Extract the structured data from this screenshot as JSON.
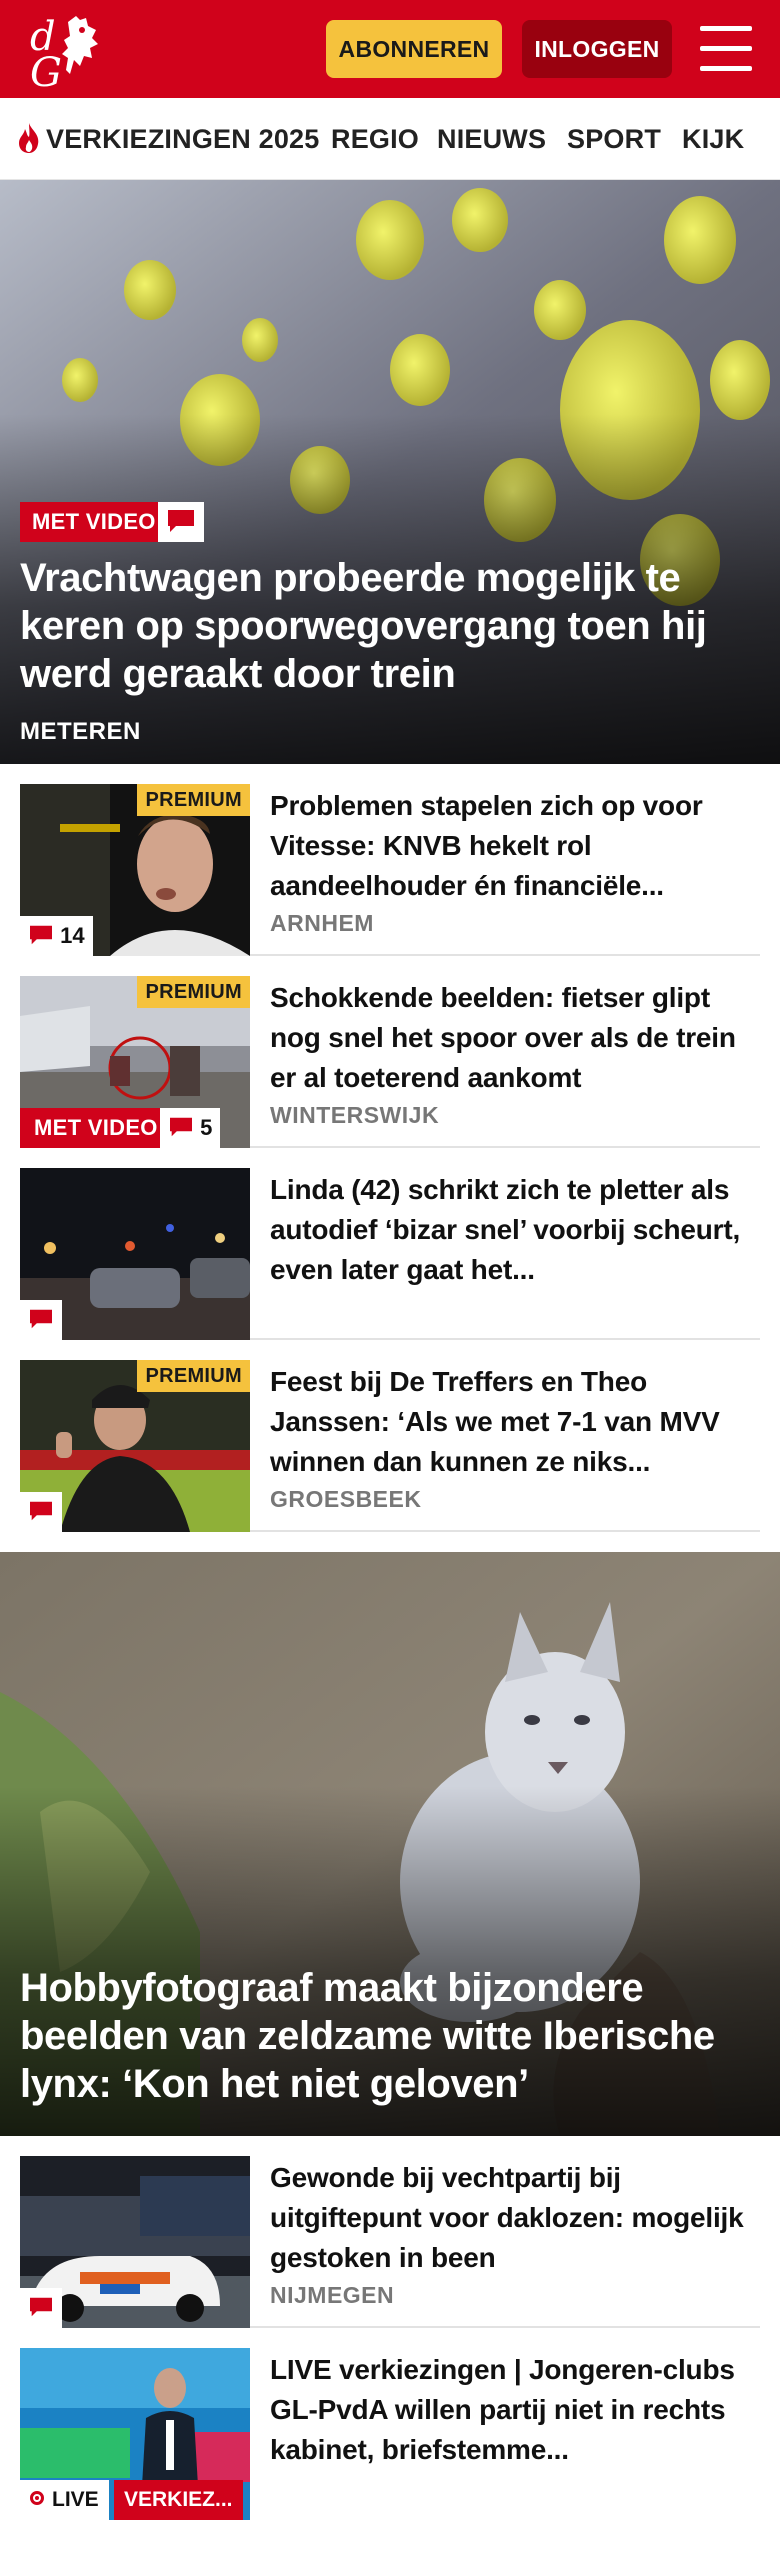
{
  "header": {
    "subscribe_label": "ABONNEREN",
    "login_label": "INLOGGEN",
    "brand_color": "#d0021b",
    "subscribe_color": "#f5c23d"
  },
  "nav": {
    "items": [
      "VERKIEZINGEN 2025",
      "REGIO",
      "NIEUWS",
      "SPORT",
      "KIJK"
    ]
  },
  "hero1": {
    "tag": "MET VIDEO",
    "title": "Vrachtwagen probeerde mogelijk te keren op spoorwegovergang toen hij werd geraakt door trein",
    "place": "METEREN"
  },
  "articles": [
    {
      "title": "Problemen stapelen zich op voor Vitesse: KNVB hekelt rol aandeelhouder én financiële...",
      "place": "ARNHEM",
      "premium": "PREMIUM",
      "comments": "14"
    },
    {
      "title": "Schokkende beelden: fietser glipt nog snel het spoor over als de trein er al toeterend aankomt",
      "place": "WINTERSWIJK",
      "premium": "PREMIUM",
      "video": "MET VIDEO",
      "comments": "5"
    },
    {
      "title": "Linda (42) schrikt zich te pletter als autodief ‘bizar snel’ voorbij scheurt, even later gaat het...",
      "place": ""
    },
    {
      "title": "Feest bij De Treffers en Theo Janssen: ‘Als we met 7-1 van MVV winnen dan kunnen ze niks...",
      "place": "GROESBEEK",
      "premium": "PREMIUM"
    }
  ],
  "hero2": {
    "title": "Hobbyfotograaf maakt bijzondere beelden van zeldzame witte Iberische lynx: ‘Kon het niet geloven’"
  },
  "articles2": [
    {
      "title": "Gewonde bij vechtpartij bij uitgiftepunt voor daklozen: mogelijk gestoken in been",
      "place": "NIJMEGEN"
    },
    {
      "title": "LIVE verkiezingen | Jongeren-clubs GL-PvdA willen partij niet in rechts kabinet, briefstemme...",
      "live": "LIVE",
      "category": "VERKIEZ..."
    }
  ]
}
